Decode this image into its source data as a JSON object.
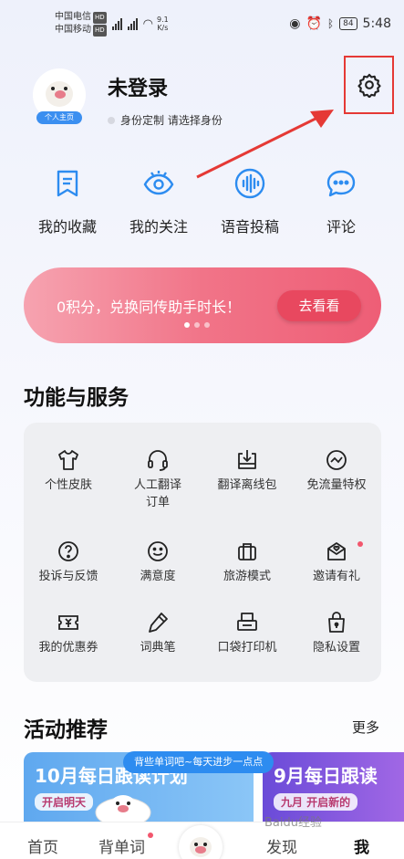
{
  "status_bar": {
    "carrier_1": "中国电信",
    "carrier_2": "中国移动",
    "hd_badge": "HD",
    "net_speed_value": "9.1",
    "net_speed_unit": "K/s",
    "battery": "84",
    "time": "5:48"
  },
  "profile": {
    "title": "未登录",
    "home_chip": "个人主页",
    "subtitle": "身份定制 请选择身份"
  },
  "quick_actions": [
    {
      "label": "我的收藏",
      "icon": "bookmark-icon"
    },
    {
      "label": "我的关注",
      "icon": "eye-icon"
    },
    {
      "label": "语音投稿",
      "icon": "voice-wave-icon"
    },
    {
      "label": "评论",
      "icon": "comment-icon"
    }
  ],
  "banner": {
    "text": "0积分，兑换同传助手时长！",
    "button": "去看看",
    "page_count": 3,
    "active_page": 1
  },
  "services": {
    "title": "功能与服务",
    "items": [
      {
        "label": "个性皮肤",
        "icon": "tshirt-icon"
      },
      {
        "label": "人工翻译订单",
        "icon": "headset-icon"
      },
      {
        "label": "翻译离线包",
        "icon": "download-box-icon"
      },
      {
        "label": "免流量特权",
        "icon": "trend-circle-icon"
      },
      {
        "label": "投诉与反馈",
        "icon": "question-circle-icon"
      },
      {
        "label": "满意度",
        "icon": "smiley-icon"
      },
      {
        "label": "旅游模式",
        "icon": "suitcase-icon"
      },
      {
        "label": "邀请有礼",
        "icon": "envelope-heart-icon"
      },
      {
        "label": "我的优惠券",
        "icon": "coupon-icon"
      },
      {
        "label": "词典笔",
        "icon": "pen-icon"
      },
      {
        "label": "口袋打印机",
        "icon": "printer-icon"
      },
      {
        "label": "隐私设置",
        "icon": "lock-bag-icon"
      }
    ]
  },
  "activities": {
    "title": "活动推荐",
    "more": "更多",
    "tip": "背些单词吧~每天进步一点点",
    "cards": [
      {
        "title": "10月每日跟读计划",
        "sub": "开启明天"
      },
      {
        "title": "9月每日跟读",
        "sub": "九月 开启新的"
      }
    ]
  },
  "tabbar": {
    "tabs": [
      "首页",
      "背单词",
      "发现",
      "我"
    ],
    "active": "我"
  },
  "watermark": "Baidu经验",
  "colors": {
    "accent_blue": "#2d8cf0",
    "banner_pink": "#ee5e76",
    "annotation_red": "#e53935"
  }
}
